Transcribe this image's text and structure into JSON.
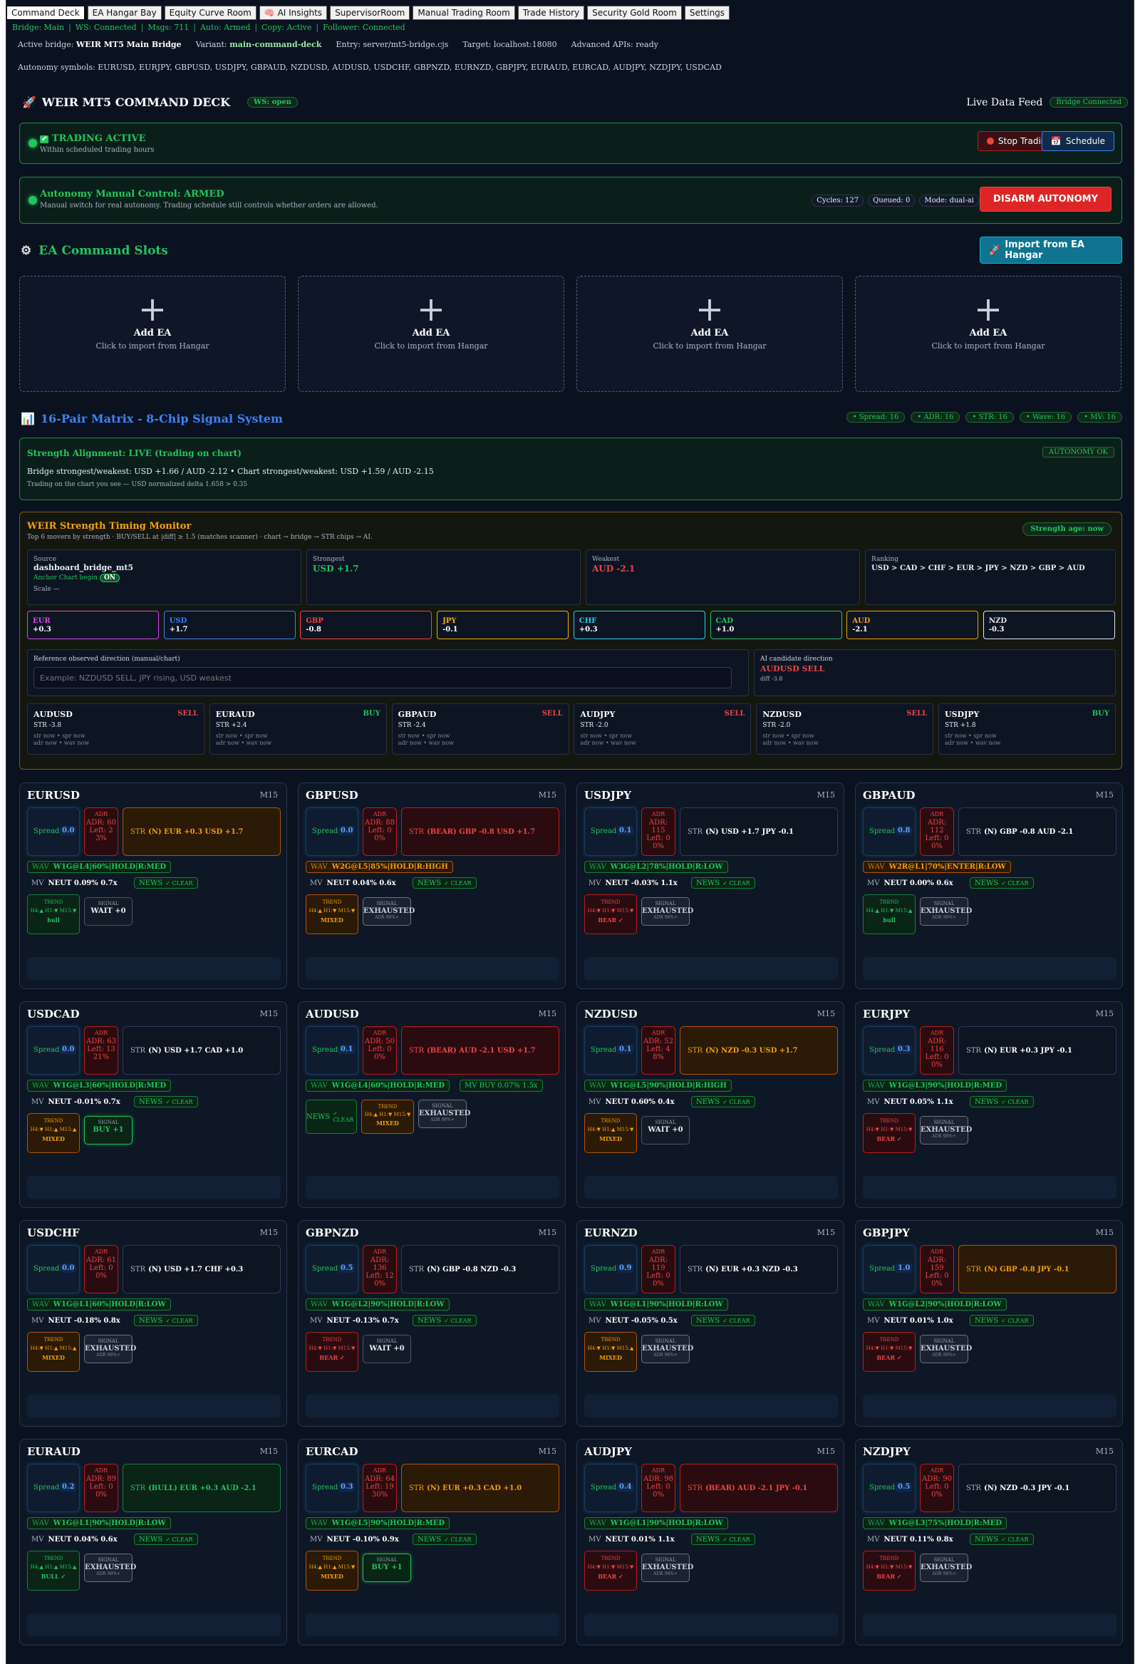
{
  "tabs": [
    "Command Deck",
    "EA Hangar Bay",
    "Equity Curve Room",
    "🧠 AI Insights",
    "SupervisorRoom",
    "Manual Trading Room",
    "Trade History",
    "Security Gold Room",
    "Settings"
  ],
  "status": [
    "Bridge: Main",
    "WS: Connected",
    "Msgs: 711",
    "Auto: Armed",
    "Copy: Active",
    "Follower: Connected"
  ],
  "bridge": {
    "active_label": "Active bridge:",
    "active": "WEIR MT5 Main Bridge",
    "variant_label": "Variant:",
    "variant": "main-command-deck",
    "entry": "Entry: server/mt5-bridge.cjs",
    "target": "Target: localhost:18080",
    "advanced": "Advanced APIs: ready"
  },
  "symbols": "Autonomy symbols: EURUSD, EURJPY, GBPUSD, USDJPY, GBPAUD, NZDUSD, AUDUSD, USDCHF, GBPNZD, EURNZD, GBPJPY, EURAUD, EURCAD, AUDJPY, NZDJPY, USDCAD",
  "deck": {
    "title": "WEIR MT5 COMMAND DECK",
    "ws": "WS: open",
    "live": "Live Data Feed",
    "bridge_connected": "Bridge Connected"
  },
  "trading": {
    "title": "TRADING ACTIVE",
    "sub": "Within scheduled trading hours",
    "stop": "Stop Trading",
    "schedule": "Schedule"
  },
  "autonomy": {
    "title": "Autonomy Manual Control: ARMED",
    "sub": "Manual switch for real autonomy. Trading schedule still controls whether orders are allowed.",
    "cycles": "Cycles: 127",
    "queued": "Queued: 0",
    "mode": "Mode: dual-ai",
    "disarm": "DISARM AUTONOMY"
  },
  "slots": {
    "title": "EA Command Slots",
    "import": "Import from EA Hangar",
    "add": "Add EA",
    "hint": "Click to import from Hangar",
    "plus": "+"
  },
  "matrix": {
    "title": "16-Pair Matrix - 8-Chip Signal System",
    "badges": [
      "Spread: 16",
      "ADR: 16",
      "STR: 16",
      "Wave: 16",
      "MV: 16"
    ]
  },
  "alignment": {
    "title": "Strength Alignment: LIVE (trading on chart)",
    "badge": "AUTONOMY OK",
    "line1": "Bridge strongest/weakest: USD +1.66 / AUD -2.12 • Chart strongest/weakest: USD +1.59 / AUD -2.15",
    "line2": "Trading on the chart you see — USD normalized delta 1.658 > 0.35"
  },
  "monitor": {
    "title": "WEIR Strength Timing Monitor",
    "sub": "Top 6 movers by strength · BUY/SELL at |diff| ≥ 1.5 (matches scanner) · chart → bridge → STR chips → AI.",
    "age": "Strength age: now",
    "source_label": "Source",
    "source": "dashboard_bridge_mt5",
    "anchor": "Anchor Chart begin",
    "on": "ON",
    "scale": "Scale —",
    "strongest_label": "Strongest",
    "strongest": "USD +1.7",
    "weakest_label": "Weakest",
    "weakest": "AUD -2.1",
    "ranking_label": "Ranking",
    "ranking": "USD > CAD > CHF > EUR > JPY > NZD > GBP > AUD",
    "currencies": [
      {
        "c": "EUR",
        "v": "+0.3",
        "col": "#d946ef"
      },
      {
        "c": "USD",
        "v": "+1.7",
        "col": "#3b82f6"
      },
      {
        "c": "GBP",
        "v": "-0.8",
        "col": "#ef4444"
      },
      {
        "c": "JPY",
        "v": "-0.1",
        "col": "#eab308"
      },
      {
        "c": "CHF",
        "v": "+0.3",
        "col": "#22d3ee"
      },
      {
        "c": "CAD",
        "v": "+1.0",
        "col": "#22c55e"
      },
      {
        "c": "AUD",
        "v": "-2.1",
        "col": "#f59e0b"
      },
      {
        "c": "NZD",
        "v": "-0.3",
        "col": "#e5e7eb"
      }
    ],
    "ref_label": "Reference observed direction (manual/chart)",
    "ref_placeholder": "Example: NZDUSD SELL, JPY rising, USD weakest",
    "ai_label": "AI candidate direction",
    "ai": "AUDUSD SELL",
    "ai_diff": "diff -3.8",
    "movers": [
      {
        "p": "AUDUSD",
        "s": "SELL",
        "str": "STR -3.8"
      },
      {
        "p": "EURAUD",
        "s": "BUY",
        "str": "STR +2.4"
      },
      {
        "p": "GBPAUD",
        "s": "SELL",
        "str": "STR -2.4"
      },
      {
        "p": "AUDJPY",
        "s": "SELL",
        "str": "STR -2.0"
      },
      {
        "p": "NZDUSD",
        "s": "SELL",
        "str": "STR -2.0"
      },
      {
        "p": "USDJPY",
        "s": "BUY",
        "str": "STR +1.8"
      }
    ],
    "mover_l1": "str now • spr now",
    "mover_l2": "adr now • wav now"
  },
  "pairs": [
    {
      "name": "EURUSD",
      "tf": "M15",
      "spread": "0.0",
      "adr": "ADR: 60",
      "left": "Left: 2",
      "pct": "3%",
      "str": "(N) EUR +0.3 USD +1.7",
      "strc": "o",
      "wav": "W1G@L4|60%|HOLD|R:MED",
      "wavc": "g",
      "mv": "NEUT 0.09% 0.7x",
      "trend": "H4:▲ H1:▼ M15:▼",
      "trendv": "bull",
      "trendc": "g",
      "sig": "WAIT +0",
      "sigc": "w"
    },
    {
      "name": "GBPUSD",
      "tf": "M15",
      "spread": "0.0",
      "adr": "ADR: 88",
      "left": "Left: 0",
      "pct": "0%",
      "str": "(BEAR) GBP -0.8 USD +1.7",
      "strc": "r",
      "wav": "W2G@L5|85%|HOLD|R:HIGH",
      "wavc": "o",
      "mv": "NEUT 0.04% 0.6x",
      "trend": "H4:▲ H1:▼ M15:▼",
      "trendv": "MIXED",
      "trendc": "o",
      "sig": "EXHAUSTED",
      "sigc": "e"
    },
    {
      "name": "USDJPY",
      "tf": "M15",
      "spread": "0.1",
      "adr": "ADR: 115",
      "left": "Left: 0",
      "pct": "0%",
      "str": "(N) USD +1.7 JPY -0.1",
      "strc": "n",
      "wav": "W3G@L2|78%|HOLD|R:LOW",
      "wavc": "g",
      "mv": "NEUT -0.03% 1.1x",
      "trend": "H4:▼ H1:▼ M15:▼",
      "trendv": "BEAR ✓",
      "trendc": "r",
      "sig": "EXHAUSTED",
      "sigc": "e"
    },
    {
      "name": "GBPAUD",
      "tf": "M15",
      "spread": "0.8",
      "adr": "ADR: 112",
      "left": "Left: 0",
      "pct": "0%",
      "str": "(N) GBP -0.8 AUD -2.1",
      "strc": "n",
      "wav": "W2R@L1|70%|ENTER|R:LOW",
      "wavc": "o",
      "mv": "NEUT 0.00% 0.6x",
      "trend": "H4:▲ H1:▼ M15:▲",
      "trendv": "bull",
      "trendc": "g",
      "sig": "EXHAUSTED",
      "sigc": "e"
    },
    {
      "name": "USDCAD",
      "tf": "M15",
      "spread": "0.0",
      "adr": "ADR: 63",
      "left": "Left: 13",
      "pct": "21%",
      "str": "(N) USD +1.7 CAD +1.0",
      "strc": "n",
      "wav": "W1G@L3|60%|HOLD|R:MED",
      "wavc": "g",
      "mv": "NEUT -0.01% 0.7x",
      "trend": "H4:▼ H1:▲ M15:▲",
      "trendv": "MIXED",
      "trendc": "o",
      "sig": "BUY +1",
      "sigc": "b"
    },
    {
      "name": "AUDUSD",
      "tf": "M15",
      "spread": "0.1",
      "adr": "ADR: 50",
      "left": "Left: 0",
      "pct": "0%",
      "str": "(BEAR) AUD -2.1 USD +1.7",
      "strc": "r",
      "wav": "W1G@L4|60%|HOLD|R:MED",
      "wavc": "g",
      "mvbuy": "MV BUY 0.07% 1.5x",
      "trend": "H4:▲ H1:▼ M15:▼",
      "trendv": "MIXED",
      "trendc": "o",
      "sig": "EXHAUSTED",
      "sigc": "e",
      "alt": true
    },
    {
      "name": "NZDUSD",
      "tf": "M15",
      "spread": "0.1",
      "adr": "ADR: 52",
      "left": "Left: 4",
      "pct": "8%",
      "str": "(N) NZD -0.3 USD +1.7",
      "strc": "o",
      "wav": "W1G@L5|90%|HOLD|R:HIGH",
      "wavc": "g",
      "mv": "NEUT 0.60% 0.4x",
      "trend": "H4:▼ H1:▲ M15:▼",
      "trendv": "MIXED",
      "trendc": "o",
      "sig": "WAIT +0",
      "sigc": "w"
    },
    {
      "name": "EURJPY",
      "tf": "M15",
      "spread": "0.3",
      "adr": "ADR: 116",
      "left": "Left: 0",
      "pct": "0%",
      "str": "(N) EUR +0.3 JPY -0.1",
      "strc": "n",
      "wav": "W1G@L3|90%|HOLD|R:MED",
      "wavc": "g",
      "mv": "NEUT 0.05% 1.1x",
      "trend": "H4:▼ H1:▼ M15:▼",
      "trendv": "BEAR ✓",
      "trendc": "r",
      "sig": "EXHAUSTED",
      "sigc": "e"
    },
    {
      "name": "USDCHF",
      "tf": "M15",
      "spread": "0.0",
      "adr": "ADR: 61",
      "left": "Left: 0",
      "pct": "0%",
      "str": "(N) USD +1.7 CHF +0.3",
      "strc": "n",
      "wav": "W1G@L1|60%|HOLD|R:LOW",
      "wavc": "g",
      "mv": "NEUT -0.18% 0.8x",
      "trend": "H4:▼ H1:▲ M15:▲",
      "trendv": "MIXED",
      "trendc": "o",
      "sig": "EXHAUSTED",
      "sigc": "e"
    },
    {
      "name": "GBPNZD",
      "tf": "M15",
      "spread": "0.5",
      "adr": "ADR: 136",
      "left": "Left: 12",
      "pct": "0%",
      "str": "(N) GBP -0.8 NZD -0.3",
      "strc": "n",
      "wav": "W1G@L2|90%|HOLD|R:LOW",
      "wavc": "g",
      "mv": "NEUT -0.13% 0.7x",
      "trend": "H4:▼ H1:▼ M15:▼",
      "trendv": "BEAR ✓",
      "trendc": "r",
      "sig": "WAIT +0",
      "sigc": "w"
    },
    {
      "name": "EURNZD",
      "tf": "M15",
      "spread": "0.9",
      "adr": "ADR: 119",
      "left": "Left: 0",
      "pct": "0%",
      "str": "(N) EUR +0.3 NZD -0.3",
      "strc": "n",
      "wav": "W1G@L1|90%|HOLD|R:LOW",
      "wavc": "g",
      "mv": "NEUT -0.05% 0.5x",
      "trend": "H4:▼ H1:▼ M15:▲",
      "trendv": "MIXED",
      "trendc": "o",
      "sig": "EXHAUSTED",
      "sigc": "e"
    },
    {
      "name": "GBPJPY",
      "tf": "M15",
      "spread": "1.0",
      "adr": "ADR: 159",
      "left": "Left: 0",
      "pct": "0%",
      "str": "(N) GBP -0.8 JPY -0.1",
      "strc": "o",
      "wav": "W1G@L2|90%|HOLD|R:LOW",
      "wavc": "g",
      "mv": "NEUT 0.01% 1.0x",
      "trend": "H4:▼ H1:▼ M15:▼",
      "trendv": "BEAR ✓",
      "trendc": "r",
      "sig": "EXHAUSTED",
      "sigc": "e"
    },
    {
      "name": "EURAUD",
      "tf": "M15",
      "spread": "0.2",
      "adr": "ADR: 89",
      "left": "Left: 0",
      "pct": "0%",
      "str": "(BULL) EUR +0.3 AUD -2.1",
      "strc": "g",
      "wav": "W1G@L1|90%|HOLD|R:LOW",
      "wavc": "g",
      "mv": "NEUT 0.04% 0.6x",
      "trend": "H4:▲ H1:▲ M15:▲",
      "trendv": "BULL ✓",
      "trendc": "g",
      "sig": "EXHAUSTED",
      "sigc": "e"
    },
    {
      "name": "EURCAD",
      "tf": "M15",
      "spread": "0.3",
      "adr": "ADR: 64",
      "left": "Left: 19",
      "pct": "30%",
      "str": "(N) EUR +0.3 CAD +1.0",
      "strc": "o",
      "wav": "W1G@L5|90%|HOLD|R:MED",
      "wavc": "g",
      "mv": "NEUT -0.10% 0.9x",
      "trend": "H4:▲ H1:▲ M15:▼",
      "trendv": "MIXED",
      "trendc": "o",
      "sig": "BUY +1",
      "sigc": "b"
    },
    {
      "name": "AUDJPY",
      "tf": "M15",
      "spread": "0.4",
      "adr": "ADR: 98",
      "left": "Left: 0",
      "pct": "0%",
      "str": "(BEAR) AUD -2.1 JPY -0.1",
      "strc": "r",
      "wav": "W1G@L1|90%|HOLD|R:LOW",
      "wavc": "g",
      "mv": "NEUT 0.01% 1.1x",
      "trend": "H4:▼ H1:▼ M15:▼",
      "trendv": "BEAR ✓",
      "trendc": "r",
      "sig": "EXHAUSTED",
      "sigc": "e"
    },
    {
      "name": "NZDJPY",
      "tf": "M15",
      "spread": "0.5",
      "adr": "ADR: 90",
      "left": "Left: 0",
      "pct": "0%",
      "str": "(N) NZD -0.3 JPY -0.1",
      "strc": "n",
      "wav": "W1G@L3|75%|HOLD|R:MED",
      "wavc": "g",
      "mv": "NEUT 0.11% 0.8x",
      "trend": "H4:▼ H1:▼ M15:▼",
      "trendv": "BEAR ✓",
      "trendc": "r",
      "sig": "EXHAUSTED",
      "sigc": "e"
    }
  ],
  "chiplabels": {
    "spread": "Spread",
    "adr": "ADR",
    "str": "STR",
    "wav": "WAV",
    "mv": "MV",
    "news": "NEWS",
    "clear": "✓ CLEAR",
    "trend": "TREND",
    "signal": "SIGNAL",
    "adr98": "ADR 98%+"
  },
  "colors": {
    "bg": "#0a1220",
    "green": "#22c55e",
    "red": "#ef4444",
    "orange": "#f59e0b",
    "blue": "#3b82f6",
    "cyan": "#06b6d4"
  }
}
